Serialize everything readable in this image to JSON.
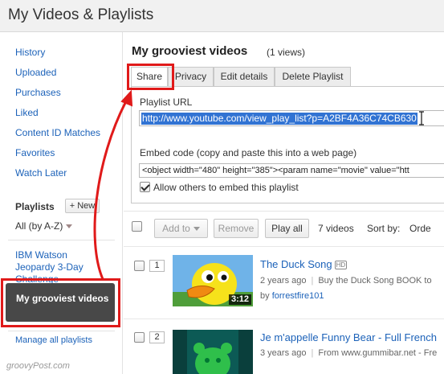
{
  "header": {
    "title": "My Videos & Playlists"
  },
  "sidebar": {
    "links": [
      "History",
      "Uploaded",
      "Purchases",
      "Liked",
      "Content ID Matches",
      "Favorites",
      "Watch Later"
    ],
    "playlists_heading": "Playlists",
    "new_button": "+ New",
    "sort_label": "All (by A-Z)",
    "playlists": [
      {
        "label": "IBM Watson Jeopardy 3-Day Challenge"
      },
      {
        "label": "My grooviest videos",
        "selected": true
      }
    ],
    "manage_link": "Manage all playlists"
  },
  "main": {
    "playlist_title": "My grooviest videos",
    "views": "(1 views)",
    "tabs": [
      {
        "label": "Share",
        "active": true
      },
      {
        "label": "Privacy"
      },
      {
        "label": "Edit details"
      },
      {
        "label": "Delete Playlist"
      }
    ],
    "share": {
      "url_label": "Playlist URL",
      "url_value": "http://www.youtube.com/view_play_list?p=A2BF4A36C74CB630",
      "embed_label": "Embed code (copy and paste this into a web page)",
      "embed_value": "<object width=\"480\" height=\"385\"><param name=\"movie\" value=\"htt",
      "allow_embed_label": "Allow others to embed this playlist",
      "allow_embed_checked": true
    },
    "toolbar": {
      "add_to": "Add to",
      "remove": "Remove",
      "play_all": "Play all",
      "count": "7 videos",
      "sort_label": "Sort by:",
      "sort_value": "Orde"
    },
    "videos": [
      {
        "position": "1",
        "title": "The Duck Song",
        "hd": "HD",
        "duration": "3:12",
        "age": "2 years ago",
        "description": "Buy the Duck Song BOOK to",
        "by_prefix": "by",
        "author": "forrestfire101"
      },
      {
        "position": "2",
        "title": "Je m'appelle Funny Bear - Full French",
        "age": "3 years ago",
        "description": "From www.gummibar.net - Fre"
      }
    ]
  },
  "colors": {
    "link": "#1c62b9",
    "highlight": "#e01a1a",
    "selection": "#3173d3",
    "selected_playlist_bg": "#484848"
  },
  "watermark": "groovyPost.com"
}
